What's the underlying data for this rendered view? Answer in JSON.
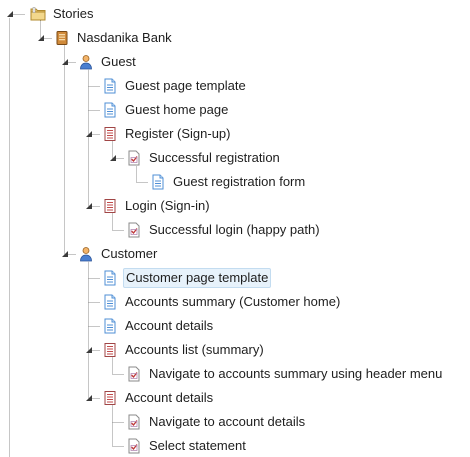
{
  "tree": {
    "nodes": [
      {
        "id": "stories",
        "label": "Stories",
        "icon": "folder-icon",
        "level": 0,
        "expanded": true
      },
      {
        "id": "nasdanika-bank",
        "label": "Nasdanika Bank",
        "icon": "book-icon",
        "level": 1,
        "expanded": true
      },
      {
        "id": "guest",
        "label": "Guest",
        "icon": "user-icon",
        "level": 2,
        "expanded": true
      },
      {
        "id": "guest-page-template",
        "label": "Guest page template",
        "icon": "page-icon",
        "level": 3
      },
      {
        "id": "guest-home-page",
        "label": "Guest home page",
        "icon": "page-icon",
        "level": 3
      },
      {
        "id": "register",
        "label": "Register (Sign-up)",
        "icon": "story-icon",
        "level": 3,
        "expanded": true
      },
      {
        "id": "successful-registration",
        "label": "Successful registration",
        "icon": "scenario-icon",
        "level": 4,
        "expanded": true
      },
      {
        "id": "guest-registration-form",
        "label": "Guest registration form",
        "icon": "page-icon",
        "level": 5
      },
      {
        "id": "login",
        "label": "Login (Sign-in)",
        "icon": "story-icon",
        "level": 3,
        "expanded": true
      },
      {
        "id": "successful-login",
        "label": "Successful login (happy path)",
        "icon": "scenario-icon",
        "level": 4
      },
      {
        "id": "customer",
        "label": "Customer",
        "icon": "user-icon",
        "level": 2,
        "expanded": true
      },
      {
        "id": "customer-page-template",
        "label": "Customer page template",
        "icon": "page-icon",
        "level": 3,
        "selected": true
      },
      {
        "id": "accounts-summary",
        "label": "Accounts summary (Customer home)",
        "icon": "page-icon",
        "level": 3
      },
      {
        "id": "account-details-page",
        "label": "Account details",
        "icon": "page-icon",
        "level": 3
      },
      {
        "id": "accounts-list",
        "label": "Accounts list (summary)",
        "icon": "story-icon",
        "level": 3,
        "expanded": true
      },
      {
        "id": "navigate-accounts-summary",
        "label": "Navigate to accounts summary using header menu",
        "icon": "scenario-icon",
        "level": 4
      },
      {
        "id": "account-details-story",
        "label": "Account details",
        "icon": "story-icon",
        "level": 3,
        "expanded": true
      },
      {
        "id": "navigate-account-details",
        "label": "Navigate to account details",
        "icon": "scenario-icon",
        "level": 4
      },
      {
        "id": "select-statement",
        "label": "Select statement",
        "icon": "scenario-icon",
        "level": 4
      }
    ]
  },
  "colors": {
    "guide_line": "#8c8c8c",
    "selection_bg": "#e7f2fb",
    "selection_border": "#c3dcf0",
    "text": "#1e1e1e"
  }
}
